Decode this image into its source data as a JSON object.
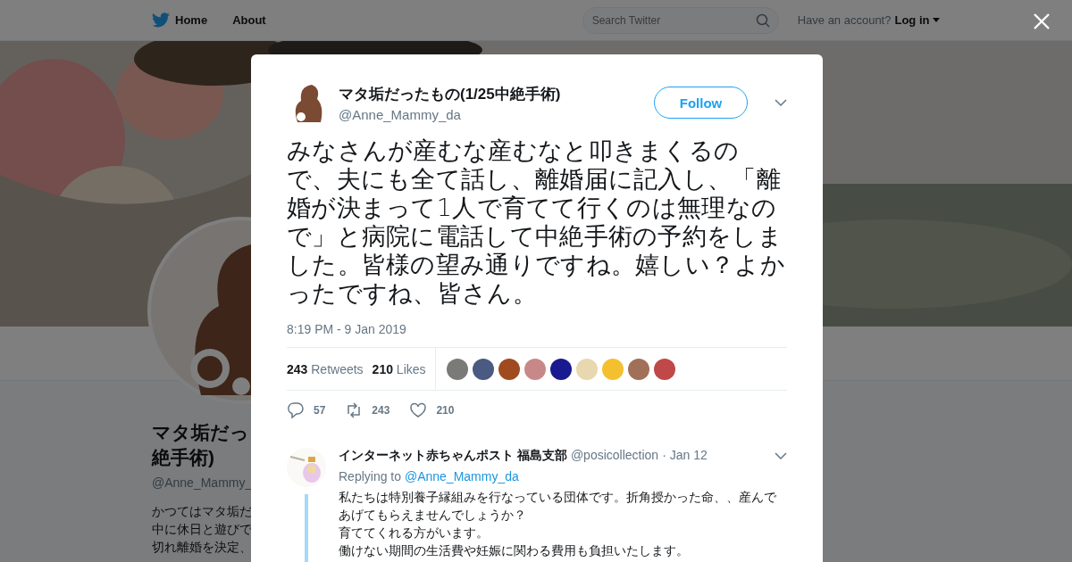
{
  "header": {
    "nav": [
      "Home",
      "About"
    ],
    "search": {
      "placeholder": "Search Twitter"
    },
    "account_prompt": "Have an account?",
    "login": "Log in"
  },
  "profile": {
    "name_lines": [
      "マタ垢だっ",
      "絶手術)"
    ],
    "handle": "@Anne_Mammy_",
    "bio_lines": [
      "かつてはマタ垢だ",
      "中に休日と遊びで",
      "切れ離婚を決定、"
    ]
  },
  "tweet": {
    "name": "マタ垢だったもの(1/25中絶手術)",
    "handle": "@Anne_Mammy_da",
    "follow": "Follow",
    "text": "みなさんが産むな産むなと叩きまくるので、夫にも全て話し、離婚届に記入し、「離婚が決まって1人で育てて行くのは無理なので」と病院に電話して中絶手術の予約をしました。皆様の望み通りですね。嬉しい？よかったですね、皆さん。",
    "time": "8:19 PM - 9 Jan 2019",
    "stats": [
      {
        "count": "243",
        "label": "Retweets"
      },
      {
        "count": "210",
        "label": "Likes"
      }
    ],
    "likers": [
      {
        "color": "#7a7a78"
      },
      {
        "color": "#4a5a80"
      },
      {
        "color": "#a04a20"
      },
      {
        "color": "#c88888"
      },
      {
        "color": "#1a1a90"
      },
      {
        "color": "#e8d8b0"
      },
      {
        "color": "#f5c030"
      },
      {
        "color": "#a07058"
      },
      {
        "color": "#c04848"
      }
    ],
    "actions": [
      {
        "kind": "reply",
        "count": "57"
      },
      {
        "kind": "retweet",
        "count": "243"
      },
      {
        "kind": "like",
        "count": "210"
      }
    ]
  },
  "reply": {
    "name": "インターネット赤ちゃんポスト 福島支部",
    "handle": "@posicollection",
    "date": "· Jan 12",
    "replying_to": "Replying to",
    "mention": "@Anne_Mammy_da",
    "lines": [
      "私たちは特別養子縁組みを行なっている団体です。折角授かった命、、産んで",
      "あげてもらえませんでしょうか？",
      "育ててくれる方がいます。",
      "働けない期間の生活費や妊娠に関わる費用も負担いたします。"
    ]
  }
}
